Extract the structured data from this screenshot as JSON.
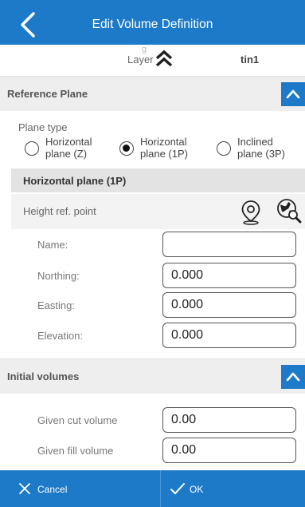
{
  "header": {
    "title": "Edit Volume Definition"
  },
  "layer": {
    "label": "Layer",
    "value": "tin1",
    "ghost_text": "g"
  },
  "reference_plane": {
    "title": "Reference Plane",
    "plane_type_label": "Plane type",
    "options": [
      {
        "line1": "Horizontal",
        "line2": "plane (Z)",
        "selected": false
      },
      {
        "line1": "Horizontal",
        "line2": "plane (1P)",
        "selected": true
      },
      {
        "line1": "Inclined",
        "line2": "plane (3P)",
        "selected": false
      }
    ],
    "subheader": "Horizontal plane (1P)",
    "height_ref_label": "Height ref. point",
    "fields": {
      "name": {
        "label": "Name:",
        "value": ""
      },
      "northing": {
        "label": "Northing:",
        "value": "0.000"
      },
      "easting": {
        "label": "Easting:",
        "value": "0.000"
      },
      "elevation": {
        "label": "Elevation:",
        "value": "0.000"
      }
    }
  },
  "initial_volumes": {
    "title": "Initial volumes",
    "cut": {
      "label": "Given cut volume",
      "value": "0.00"
    },
    "fill": {
      "label": "Given fill volume",
      "value": "0.00"
    }
  },
  "footer": {
    "cancel_label": "Cancel",
    "ok_label": "OK"
  },
  "colors": {
    "accent": "#1d7ac8",
    "section_bg": "#eeeeee"
  },
  "icons": [
    "back-arrow-icon",
    "double-chevron-up-icon",
    "chevron-up-icon",
    "map-pin-icon",
    "globe-search-icon",
    "close-icon",
    "check-icon"
  ]
}
